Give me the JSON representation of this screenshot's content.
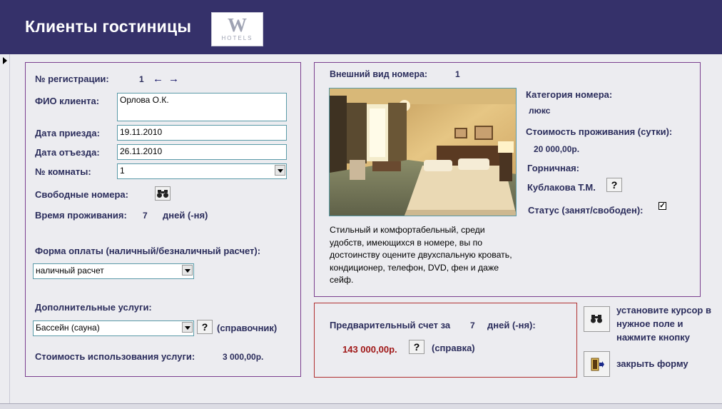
{
  "header": {
    "title": "Клиенты гостиницы",
    "logo_letter": "W",
    "logo_sub": "HOTELS"
  },
  "client": {
    "reg_label": "№ регистрации:",
    "reg_value": "1",
    "name_label": "ФИО клиента:",
    "name_value": "Орлова О.К.",
    "arrival_label": "Дата приезда:",
    "arrival_value": "19.11.2010",
    "departure_label": "Дата отъезда:",
    "departure_value": "26.11.2010",
    "room_label": "№ комнаты:",
    "room_value": "1",
    "free_rooms_label": "Свободные номера:",
    "stay_label": "Время проживания:",
    "stay_value": "7",
    "stay_unit": "дней (-ня)",
    "payment_label": "Форма оплаты (наличный/безналичный расчет):",
    "payment_value": "наличный расчет",
    "services_label": "Дополнительные услуги:",
    "services_value": "Бассейн (сауна)",
    "services_ref": "(справочник)",
    "service_cost_label": "Стоимость использования услуги:",
    "service_cost_value": "3 000,00р."
  },
  "room": {
    "appearance_label": "Внешний вид номера:",
    "appearance_value": "1",
    "category_label": "Категория номера:",
    "category_value": "люкс",
    "price_label": "Стоимость проживания (сутки):",
    "price_value": "20 000,00р.",
    "maid_label": "Горничная:",
    "maid_value": "Кублакова Т.М.",
    "status_label": "Статус (занят/свободен):",
    "status_checked": "✓",
    "description": "Стильный и комфортабельный, среди удобств, имеющихся в номере, вы по достоинству оцените двухспальную кровать, кондиционер, телефон, DVD, фен и даже сейф."
  },
  "bill": {
    "label": "Предварительный счет за",
    "days": "7",
    "unit": "дней (-ня):",
    "total": "143 000,00р.",
    "ref": "(справка)"
  },
  "actions": {
    "search_hint": "установите курсор в нужное поле и нажмите кнопку",
    "close_label": "закрыть форму"
  },
  "icons": {
    "help": "?",
    "binoculars": "binoculars-icon",
    "prev": "←",
    "next": "→"
  },
  "colors": {
    "header_bg": "#35316a",
    "panel_border": "#7b3f8f",
    "bill_border": "#b03030",
    "total_color": "#a01818"
  }
}
